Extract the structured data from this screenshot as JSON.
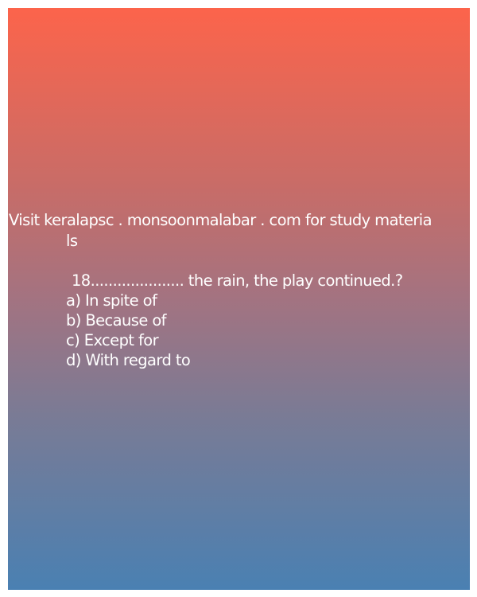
{
  "visit_line1": "Visit keralapsc . monsoonmalabar . com for study materia",
  "visit_line2": "ls",
  "question": "18..................... the rain, the play continued.?",
  "options": [
    "a) In spite of",
    "b) Because of",
    "c) Except for",
    "d) With regard to"
  ],
  "colors": {
    "gradient_top": "#fc644b",
    "gradient_bottom": "#4a80b2",
    "text": "#ffffff"
  }
}
